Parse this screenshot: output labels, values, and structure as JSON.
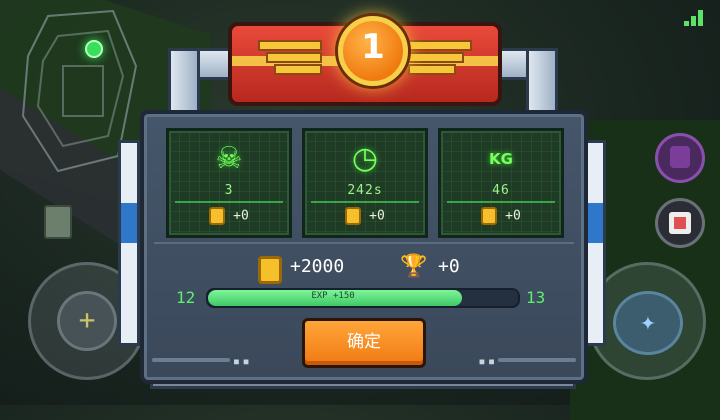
{
  "rank": {
    "number": "1"
  },
  "stats": [
    {
      "icon": "skull-icon",
      "glyph": "☠",
      "value": "3",
      "bonus": "+0"
    },
    {
      "icon": "clock-icon",
      "glyph": "◷",
      "value": "242s",
      "bonus": "+0"
    },
    {
      "icon": "weight-icon",
      "glyph": "KG",
      "value": "46",
      "bonus": "+0"
    }
  ],
  "rewards": {
    "gold": "+2000",
    "trophy": "+0"
  },
  "level": {
    "current": "12",
    "next": "13",
    "exp_label": "EXP +150",
    "exp_fraction": 0.82
  },
  "confirm_label": "确定",
  "colors": {
    "accent": "#f07a12",
    "screen_green": "#78ff5a",
    "banner_red": "#d9362a"
  }
}
